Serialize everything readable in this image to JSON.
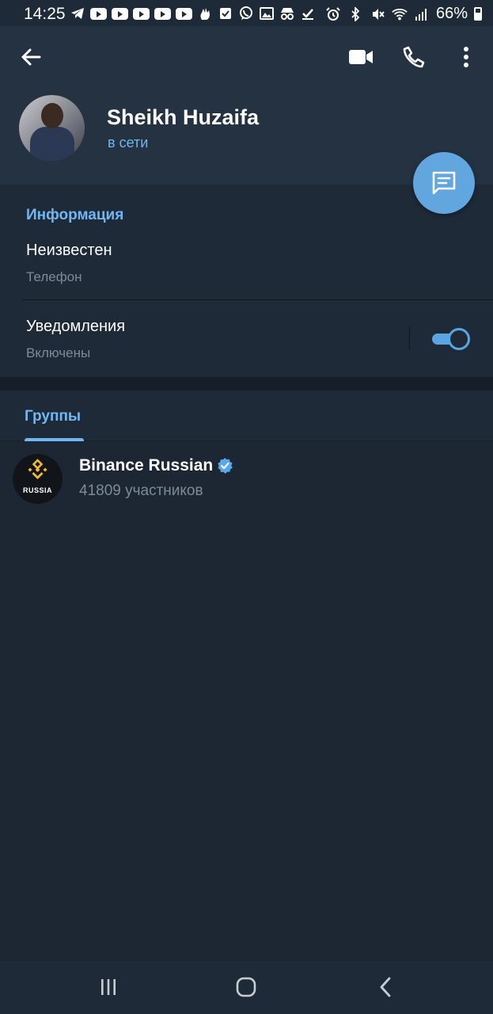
{
  "status_bar": {
    "time": "14:25",
    "battery": "66%",
    "left_icons": [
      "telegram-icon",
      "youtube-icon",
      "youtube-icon",
      "youtube-icon",
      "youtube-icon",
      "youtube-icon",
      "hand-icon",
      "checkbox-icon",
      "viber-icon",
      "gallery-icon",
      "incognito-icon",
      "check-icon"
    ],
    "right_icons": [
      "alarm-icon",
      "bluetooth-icon",
      "mute-icon",
      "wifi-icon",
      "signal-icon",
      "battery-icon"
    ]
  },
  "header": {
    "back_icon": "arrow-left-icon",
    "actions": [
      "video-call-icon",
      "phone-icon",
      "more-vert-icon"
    ],
    "contact_name": "Sheikh Huzaifa",
    "contact_status": "в сети",
    "fab_icon": "message-icon"
  },
  "info": {
    "section_title": "Информация",
    "phone_value": "Неизвестен",
    "phone_label": "Телефон",
    "notifications_title": "Уведомления",
    "notifications_value": "Включены",
    "notifications_enabled": true
  },
  "groups": {
    "tab_label": "Группы",
    "items": [
      {
        "name": "Binance Russian",
        "verified": true,
        "members": "41809 участников",
        "avatar_caption": "RUSSIA"
      }
    ]
  },
  "nav_bar": {
    "buttons": [
      "recents-icon",
      "home-icon",
      "back-icon"
    ]
  },
  "colors": {
    "background": "#1d2733",
    "header": "#253242",
    "accent": "#71b7f3",
    "fab": "#62a6e0",
    "secondary_text": "#7d8b99",
    "binance_yellow": "#f3ba2f"
  }
}
